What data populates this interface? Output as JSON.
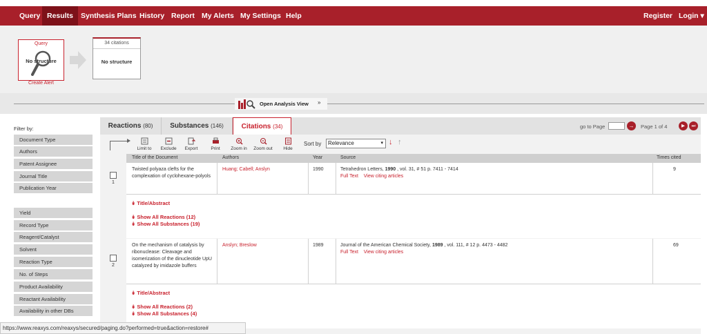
{
  "nav": {
    "left": [
      "Query",
      "Results",
      "Synthesis Plans",
      "History",
      "Report",
      "My Alerts",
      "My Settings",
      "Help"
    ],
    "right": [
      "Register",
      "Login ▾"
    ],
    "active": "Results"
  },
  "breadcrumb": {
    "query_title": "Query",
    "query_structure": "No structure",
    "create_alert": "Create Alert",
    "citations_title": "34 citations",
    "citations_structure": "No structure"
  },
  "analysis": {
    "label": "Open Analysis View"
  },
  "filter": {
    "label": "Filter by:",
    "group1": [
      "Document Type",
      "Authors",
      "Patent Assignee",
      "Journal Title",
      "Publication Year"
    ],
    "group2": [
      "Yield",
      "Record Type",
      "Reagent/Catalyst",
      "Solvent",
      "Reaction Type",
      "No. of Steps",
      "Product Availability",
      "Reactant Availability",
      "Availability in other DBs"
    ]
  },
  "tabs": [
    {
      "label": "Reactions",
      "count": "(80)"
    },
    {
      "label": "Substances",
      "count": "(146)"
    },
    {
      "label": "Citations",
      "count": "(34)"
    }
  ],
  "paging": {
    "goto": "go to Page",
    "page_info": "Page 1 of 4"
  },
  "toolbar": {
    "buttons": [
      "Limit to",
      "Exclude",
      "Export",
      "Print",
      "Zoom in",
      "Zoom out",
      "Hide"
    ],
    "sort_label": "Sort by",
    "sort_value": "Relevance"
  },
  "table": {
    "headers": [
      "Title of the Document",
      "Authors",
      "Year",
      "Source",
      "Times cited"
    ],
    "rows": [
      {
        "num": "1",
        "title": "Twisted polyaza clefts for the complexation of cyclohexane-polyols",
        "authors": "Huang; Cabell; Anslyn",
        "year": "1990",
        "source_pre": "Tetrahedron Letters, ",
        "source_year": "1990",
        "source_post": " ,  vol. 31,  # 51  p. 7411 - 7414",
        "full_text": "Full Text",
        "citing": "View citing articles",
        "cited": "9",
        "title_abstract": "Title/Abstract",
        "show_reactions": "Show All Reactions (12)",
        "show_substances": "Show All Substances (19)"
      },
      {
        "num": "2",
        "title": "On the mechanism of catalysis by ribonuclease: Cleavage and isomerization of the dinucleotide UpU catalyzed by imidazole buffers",
        "authors": "Anslyn; Breslow",
        "year": "1989",
        "source_pre": "Journal of the American Chemical Society, ",
        "source_year": "1989",
        "source_post": " ,  vol. 111,  # 12  p. 4473 - 4482",
        "full_text": "Full Text",
        "citing": "View citing articles",
        "cited": "69",
        "title_abstract": "Title/Abstract",
        "show_reactions": "Show All Reactions (2)",
        "show_substances": "Show All Substances (4)"
      }
    ]
  },
  "status_url": "https://www.reaxys.com/reaxys/secured/paging.do?performed=true&action=restore#",
  "colors": {
    "brand": "#a8202a",
    "accent": "#c8202c",
    "active_nav": "#7d1119"
  }
}
